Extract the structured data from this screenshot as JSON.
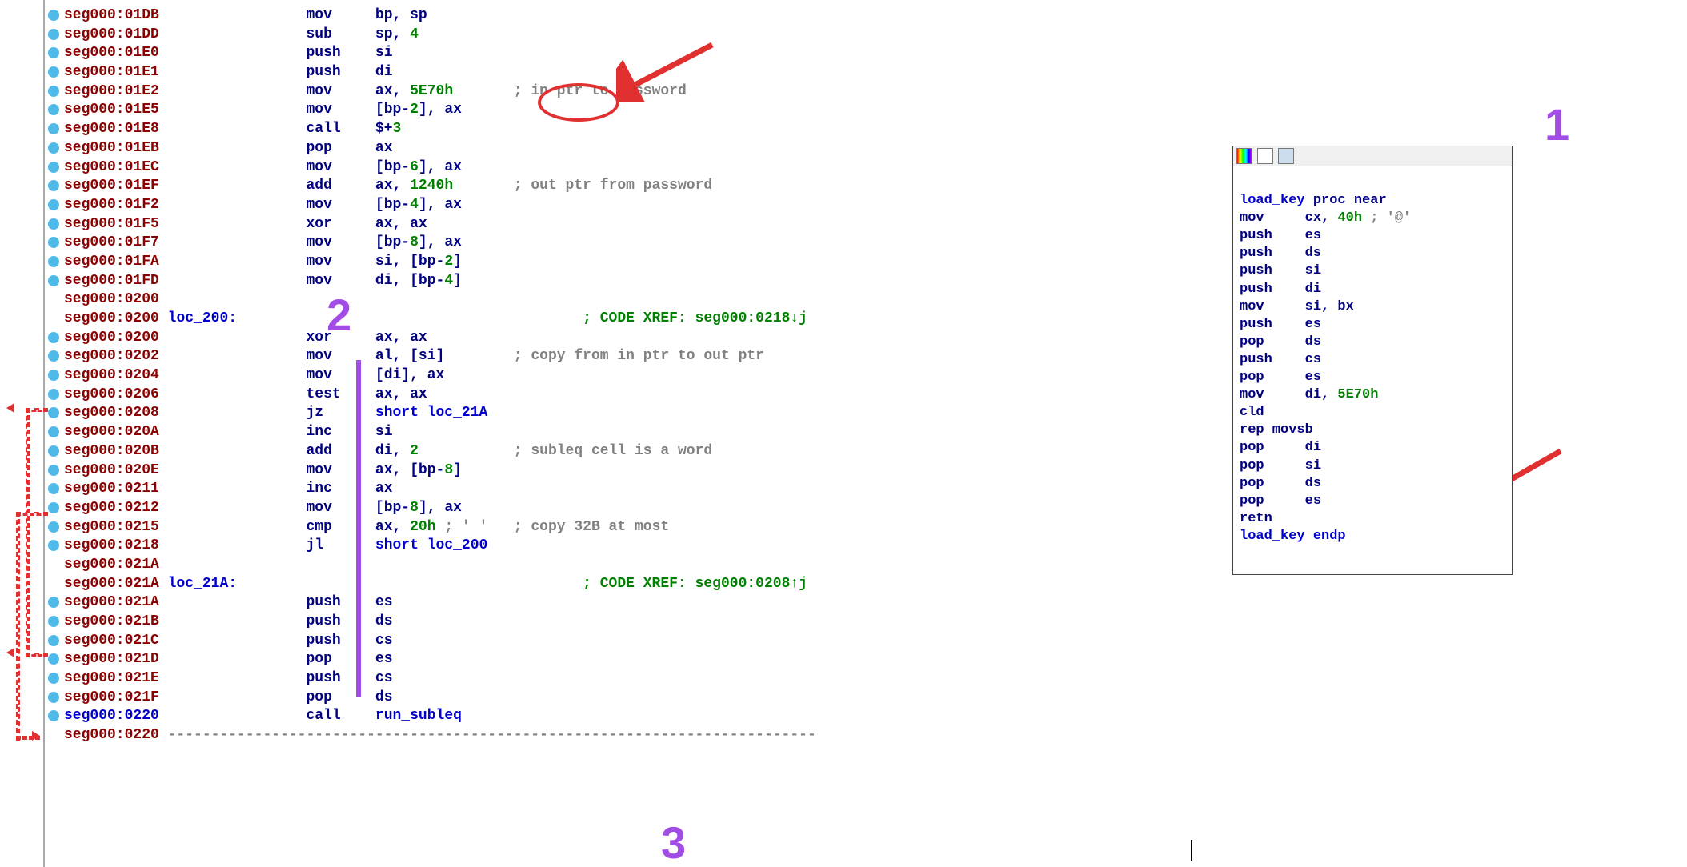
{
  "annotations": {
    "one": "1",
    "two": "2",
    "three": "3"
  },
  "popup": {
    "l0a": "load_key",
    "l0b": " proc near",
    "l1a": "mov",
    "l1b": "cx, ",
    "l1c": "40h",
    "l1d": " ; '@'",
    "l2": "push    es",
    "l3": "push    ds",
    "l4": "push    si",
    "l5": "push    di",
    "l6": "mov     si, bx",
    "l7": "push    es",
    "l8": "pop     ds",
    "l9": "push    cs",
    "l10": "pop     es",
    "l11a": "mov     di, ",
    "l11b": "5E70h",
    "l12": "cld",
    "l13": "rep movsb",
    "l14": "pop     di",
    "l15": "pop     si",
    "l16": "pop     ds",
    "l17": "pop     es",
    "l18": "retn",
    "l19": "load_key endp"
  },
  "rows": {
    "r0": {
      "addr": "seg000:01DB",
      "mne": "mov",
      "op": "bp, sp"
    },
    "r1": {
      "addr": "seg000:01DD",
      "mne": "sub",
      "op1": "sp, ",
      "op2": "4"
    },
    "r2": {
      "addr": "seg000:01E0",
      "mne": "push",
      "op": "si"
    },
    "r3": {
      "addr": "seg000:01E1",
      "mne": "push",
      "op": "di"
    },
    "r4": {
      "addr": "seg000:01E2",
      "mne": "mov",
      "op1": "ax, ",
      "op2": "5E70h",
      "cmt": "; in ptr to password"
    },
    "r5": {
      "addr": "seg000:01E5",
      "mne": "mov",
      "op1": "[bp-",
      "op2": "2",
      "op3": "], ax"
    },
    "r6": {
      "addr": "seg000:01E8",
      "mne": "call",
      "op1": "$+",
      "op2": "3"
    },
    "r7": {
      "addr": "seg000:01EB",
      "mne": "pop",
      "op": "ax"
    },
    "r8": {
      "addr": "seg000:01EC",
      "mne": "mov",
      "op1": "[bp-",
      "op2": "6",
      "op3": "], ax"
    },
    "r9": {
      "addr": "seg000:01EF",
      "mne": "add",
      "op1": "ax, ",
      "op2": "1240h",
      "cmt": "; out ptr from password"
    },
    "r10": {
      "addr": "seg000:01F2",
      "mne": "mov",
      "op1": "[bp-",
      "op2": "4",
      "op3": "], ax"
    },
    "r11": {
      "addr": "seg000:01F5",
      "mne": "xor",
      "op": "ax, ax"
    },
    "r12": {
      "addr": "seg000:01F7",
      "mne": "mov",
      "op1": "[bp-",
      "op2": "8",
      "op3": "], ax"
    },
    "r13": {
      "addr": "seg000:01FA",
      "mne": "mov",
      "op1": "si, [bp-",
      "op2": "2",
      "op3": "]"
    },
    "r14": {
      "addr": "seg000:01FD",
      "mne": "mov",
      "op1": "di, [bp-",
      "op2": "4",
      "op3": "]"
    },
    "r15": {
      "addr": "seg000:0200"
    },
    "r16": {
      "addr": "seg000:0200",
      "lbl": "loc_200:",
      "cmt": "; CODE XREF: seg000:0218↓j"
    },
    "r17": {
      "addr": "seg000:0200",
      "mne": "xor",
      "op": "ax, ax"
    },
    "r18": {
      "addr": "seg000:0202",
      "mne": "mov",
      "op": "al, [si]",
      "cmt": "; copy from in ptr to out ptr"
    },
    "r19": {
      "addr": "seg000:0204",
      "mne": "mov",
      "op": "[di], ax"
    },
    "r20": {
      "addr": "seg000:0206",
      "mne": "test",
      "op": "ax, ax"
    },
    "r21": {
      "addr": "seg000:0208",
      "mne": "jz",
      "op": "short loc_21A"
    },
    "r22": {
      "addr": "seg000:020A",
      "mne": "inc",
      "op": "si"
    },
    "r23": {
      "addr": "seg000:020B",
      "mne": "add",
      "op1": "di, ",
      "op2": "2",
      "cmt": "; subleq cell is a word"
    },
    "r24": {
      "addr": "seg000:020E",
      "mne": "mov",
      "op1": "ax, [bp-",
      "op2": "8",
      "op3": "]"
    },
    "r25": {
      "addr": "seg000:0211",
      "mne": "inc",
      "op": "ax"
    },
    "r26": {
      "addr": "seg000:0212",
      "mne": "mov",
      "op1": "[bp-",
      "op2": "8",
      "op3": "], ax"
    },
    "r27": {
      "addr": "seg000:0215",
      "mne": "cmp",
      "op1": "ax, ",
      "op2": "20h",
      "op3": " ; ' '",
      "cmt": "; copy 32B at most"
    },
    "r28": {
      "addr": "seg000:0218",
      "mne": "jl",
      "op": "short loc_200"
    },
    "r29": {
      "addr": "seg000:021A"
    },
    "r30": {
      "addr": "seg000:021A",
      "lbl": "loc_21A:",
      "cmt": "; CODE XREF: seg000:0208↑j"
    },
    "r31": {
      "addr": "seg000:021A",
      "mne": "push",
      "op": "es"
    },
    "r32": {
      "addr": "seg000:021B",
      "mne": "push",
      "op": "ds"
    },
    "r33": {
      "addr": "seg000:021C",
      "mne": "push",
      "op": "cs"
    },
    "r34": {
      "addr": "seg000:021D",
      "mne": "pop",
      "op": "es"
    },
    "r35": {
      "addr": "seg000:021E",
      "mne": "push",
      "op": "cs"
    },
    "r36": {
      "addr": "seg000:021F",
      "mne": "pop",
      "op": "ds"
    },
    "r37": {
      "addr": "seg000:0220",
      "mne": "call",
      "op": "run_subleq"
    },
    "r38": {
      "addr": "seg000:0220",
      "dash": " ---------------------------------------------------------------------------"
    }
  }
}
